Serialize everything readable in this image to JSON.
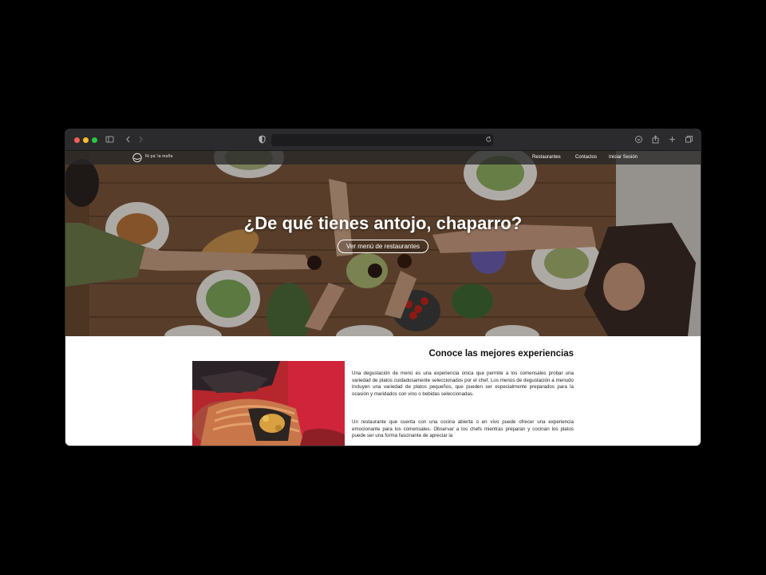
{
  "browser": {
    "toolbar_icons": [
      "sidebar-icon",
      "back-icon",
      "forward-icon",
      "shield-icon",
      "reload-icon",
      "download-icon",
      "share-icon",
      "new-tab-icon",
      "tabs-icon"
    ]
  },
  "navbar": {
    "logo_text": "Ni pa' la maña",
    "links": [
      "Restaurantes",
      "Contactos",
      "Iniciar Sesión"
    ]
  },
  "hero": {
    "title": "¿De qué tienes antojo, chaparro?",
    "button_label": "Ver menú de restaurantes"
  },
  "section": {
    "title": "Conoce las mejores experiencias",
    "paragraphs": [
      "Una degustación de menú es una experiencia única que permite a los comensales probar una variedad de platos cuidadosamente seleccionados por el chef. Los menús de degustación a menudo incluyen una variedad de platos pequeños, que pueden ser especialmente preparados para la ocasión y maridados con vino o bebidas seleccionadas.",
      "Un restaurante que cuenta con una cocina abierta o en vivo puede ofrecer una experiencia emocionante para los comensales. Observar a los chefs mientras preparan y cocinan los platos puede ser una forma fascinante de apreciar la"
    ]
  }
}
